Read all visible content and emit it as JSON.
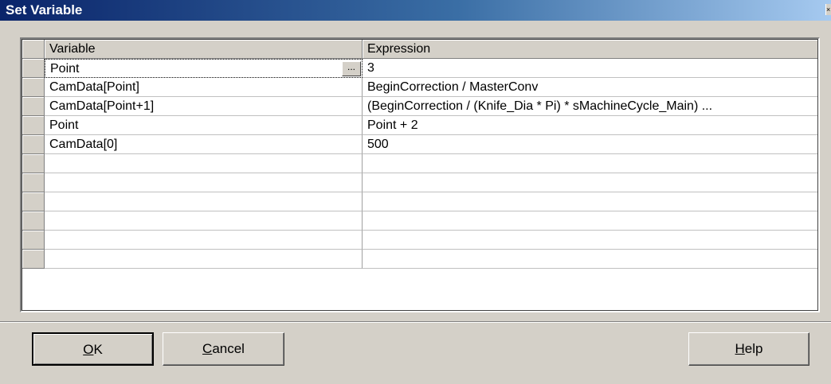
{
  "window": {
    "title": "Set Variable",
    "close_glyph": "×"
  },
  "grid": {
    "columns": [
      "Variable",
      "Expression"
    ],
    "edit_button_label": "...",
    "rows": [
      {
        "variable": "Point",
        "expression": "3"
      },
      {
        "variable": "CamData[Point]",
        "expression": "BeginCorrection / MasterConv"
      },
      {
        "variable": "CamData[Point+1]",
        "expression": "(BeginCorrection / (Knife_Dia * Pi) * sMachineCycle_Main) ..."
      },
      {
        "variable": "Point",
        "expression": "Point + 2"
      },
      {
        "variable": "CamData[0]",
        "expression": "500"
      },
      {
        "variable": "",
        "expression": ""
      },
      {
        "variable": "",
        "expression": ""
      },
      {
        "variable": "",
        "expression": ""
      },
      {
        "variable": "",
        "expression": ""
      },
      {
        "variable": "",
        "expression": ""
      },
      {
        "variable": "",
        "expression": ""
      }
    ]
  },
  "buttons": {
    "ok_mnemonic": "O",
    "ok_rest": "K",
    "cancel_mnemonic": "C",
    "cancel_rest": "ancel",
    "help_mnemonic": "H",
    "help_rest": "elp"
  }
}
